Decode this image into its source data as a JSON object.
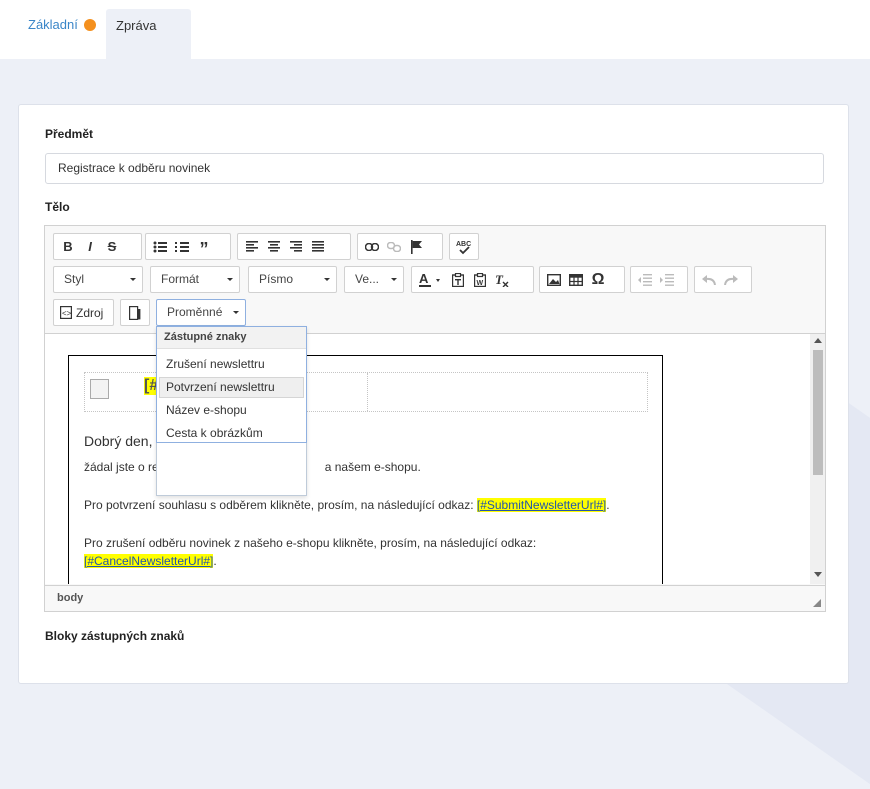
{
  "tabs": [
    {
      "label": "Základní",
      "has_indicator": true,
      "indicator_color": "#f4901e"
    },
    {
      "label": "Zpráva",
      "active": true
    }
  ],
  "form": {
    "subject_label": "Předmět",
    "subject_value": "Registrace k odběru novinek",
    "body_label": "Tělo",
    "blocks_label": "Bloky zástupných znaků"
  },
  "editor": {
    "combos": {
      "style": "Styl",
      "format": "Formát",
      "font": "Písmo",
      "size": "Ve..."
    },
    "source_label": "Zdroj",
    "variables_label": "Proměnné",
    "status_path": "body",
    "content": {
      "greeting": "Dobrý den,",
      "line1_start": "žádal jste o re",
      "line1_end": "a našem e-shopu.",
      "line2": "Pro potvrzení souhlasu s odběrem klikněte, prosím, na následující odkaz: ",
      "line2_tag": "[#SubmitNewsletterUrl#]",
      "line3": "Pro zrušení odběru novinek z našeho e-shopu klikněte, prosím, na následující odkaz:",
      "line4_tag": "[#CancelNewsletterUrl#]",
      "header_tag_fragment": "[#"
    }
  },
  "dropdown": {
    "heading": "Zástupné znaky",
    "items": [
      "Zrušení newslettru",
      "Potvrzení newslettru",
      "Název e-shopu",
      "Cesta k obrázkům"
    ],
    "highlighted_index": 1
  },
  "colors": {
    "accent": "#3a86c8",
    "indicator": "#f4901e",
    "highlight": "#ffff00"
  }
}
